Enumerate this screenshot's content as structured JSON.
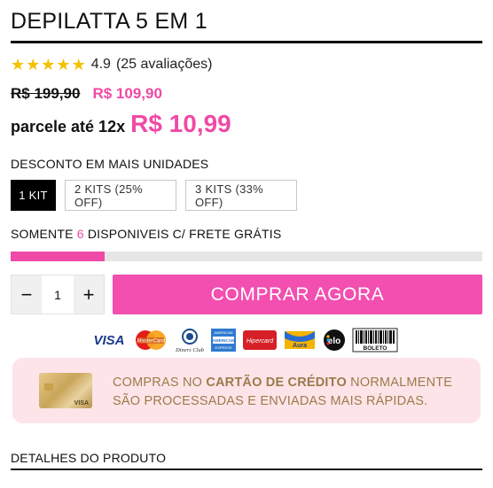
{
  "product": {
    "title": "DEPILATTA 5 EM 1",
    "rating": {
      "stars": 5,
      "value": "4.9",
      "count_text": "(25 avaliações)"
    },
    "price": {
      "old": "R$ 199,90",
      "new": "R$ 109,90"
    },
    "installment": {
      "text": "parcele até 12x",
      "value": "R$ 10,99"
    }
  },
  "discount": {
    "label": "DESCONTO EM MAIS UNIDADES",
    "options": [
      {
        "label": "1 KIT",
        "selected": true
      },
      {
        "label": "2 KITS (25% OFF)",
        "selected": false
      },
      {
        "label": "3 KITS (33% OFF)",
        "selected": false
      }
    ]
  },
  "stock": {
    "prefix": "SOMENTE",
    "count": "6",
    "suffix": "DISPONIVEIS C/ FRETE GRÁTIS",
    "level_fraction": 0.2
  },
  "quantity": {
    "minus": "−",
    "value": "1",
    "plus": "+"
  },
  "buy_button": {
    "label": "COMPRAR AGORA"
  },
  "payments": {
    "methods": [
      {
        "name": "visa-icon",
        "label": "VISA"
      },
      {
        "name": "mastercard-icon",
        "label": "MasterCard"
      },
      {
        "name": "diners-club-icon",
        "label": "Diners Club"
      },
      {
        "name": "american-express-icon",
        "label": "AMERICAN EXPRESS"
      },
      {
        "name": "hipercard-icon",
        "label": "Hipercard"
      },
      {
        "name": "aura-icon",
        "label": "Aura"
      },
      {
        "name": "elo-icon",
        "label": "elo"
      },
      {
        "name": "boleto-icon",
        "label": "BOLETO"
      }
    ]
  },
  "banner": {
    "line1_prefix": "COMPRAS NO ",
    "line1_bold": "CARTÃO DE CRÉDITO",
    "line1_suffix": " NORMALMENTE",
    "line2": "SÃO PROCESSADAS E ENVIADAS MAIS RÁPIDAS.",
    "card_brand": "VISA"
  },
  "details": {
    "label": "DETALHES DO PRODUTO"
  },
  "colors": {
    "accent": "#ef4aa6",
    "buy_button": "#f24fb0",
    "star": "#f2c200",
    "banner_bg": "#fde4e8",
    "banner_text": "#9b7b4b"
  }
}
